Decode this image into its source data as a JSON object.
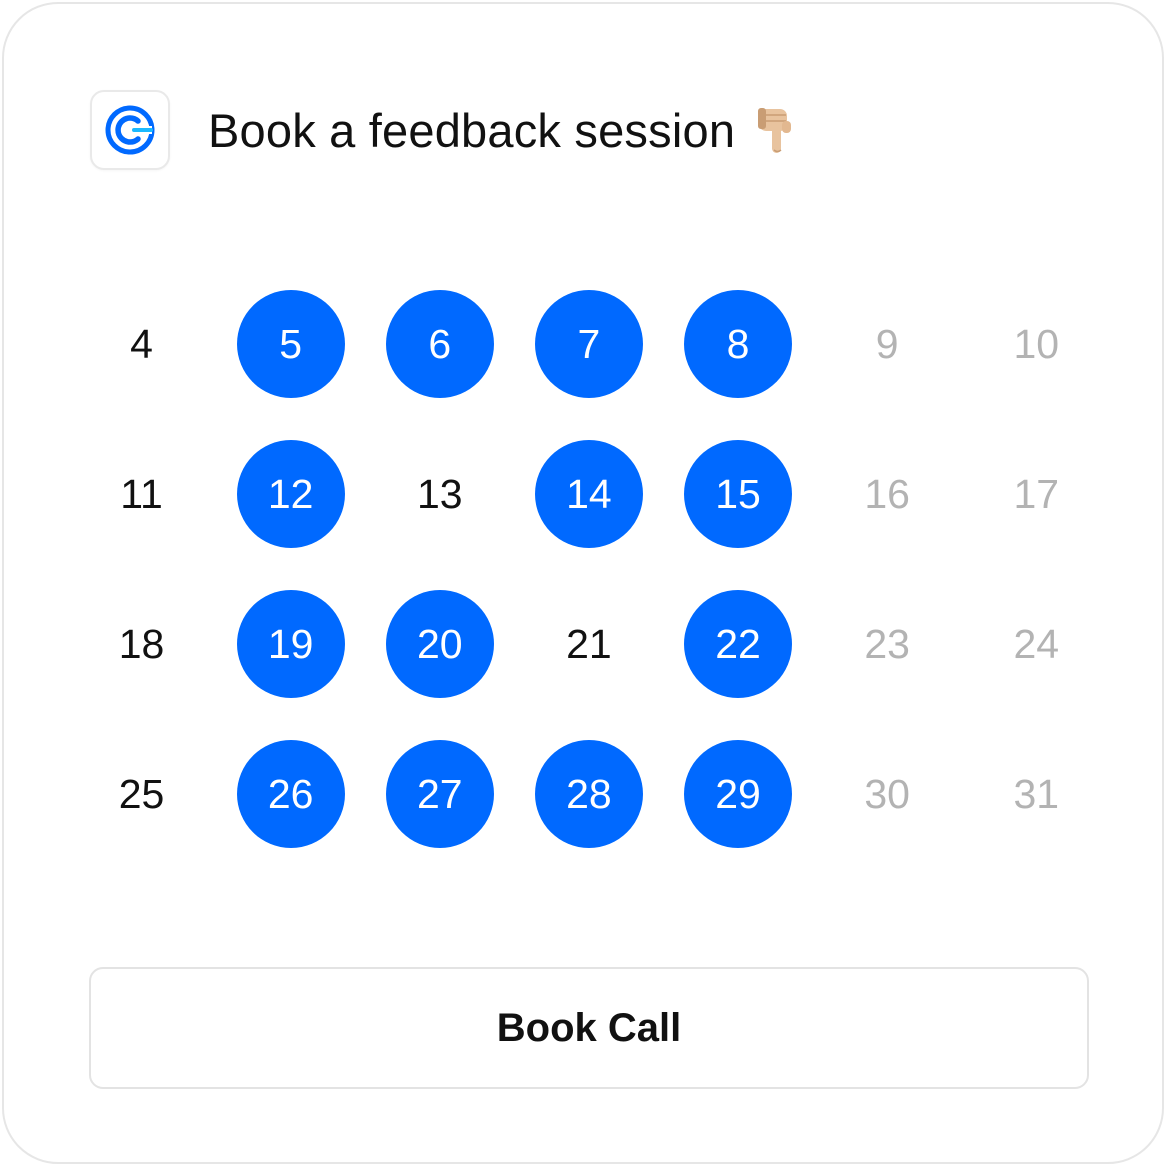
{
  "header": {
    "title": "Book a feedback session",
    "logo_icon": "calendly-logo-icon",
    "emoji_icon": "pointing-down-hand-icon"
  },
  "calendar": {
    "days": [
      {
        "label": "4",
        "state": "unavailable"
      },
      {
        "label": "5",
        "state": "available"
      },
      {
        "label": "6",
        "state": "available"
      },
      {
        "label": "7",
        "state": "available"
      },
      {
        "label": "8",
        "state": "available"
      },
      {
        "label": "9",
        "state": "weekend"
      },
      {
        "label": "10",
        "state": "weekend"
      },
      {
        "label": "11",
        "state": "unavailable"
      },
      {
        "label": "12",
        "state": "available"
      },
      {
        "label": "13",
        "state": "unavailable"
      },
      {
        "label": "14",
        "state": "available"
      },
      {
        "label": "15",
        "state": "available"
      },
      {
        "label": "16",
        "state": "weekend"
      },
      {
        "label": "17",
        "state": "weekend"
      },
      {
        "label": "18",
        "state": "unavailable"
      },
      {
        "label": "19",
        "state": "available"
      },
      {
        "label": "20",
        "state": "available"
      },
      {
        "label": "21",
        "state": "unavailable"
      },
      {
        "label": "22",
        "state": "available"
      },
      {
        "label": "23",
        "state": "weekend"
      },
      {
        "label": "24",
        "state": "weekend"
      },
      {
        "label": "25",
        "state": "unavailable"
      },
      {
        "label": "26",
        "state": "available"
      },
      {
        "label": "27",
        "state": "available"
      },
      {
        "label": "28",
        "state": "available"
      },
      {
        "label": "29",
        "state": "available"
      },
      {
        "label": "30",
        "state": "weekend"
      },
      {
        "label": "31",
        "state": "weekend"
      }
    ]
  },
  "actions": {
    "book_label": "Book Call"
  },
  "colors": {
    "accent": "#0069ff",
    "text": "#111111",
    "muted": "#b3b3b3",
    "border": "#e6e6e6"
  }
}
